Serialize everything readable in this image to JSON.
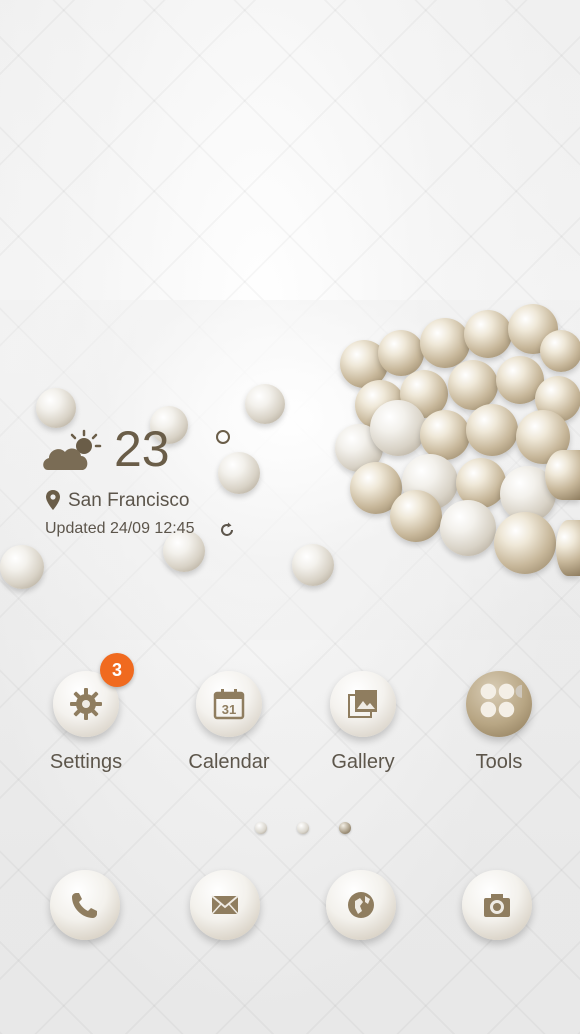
{
  "weather": {
    "temperature": "23",
    "city": "San Francisco",
    "updated": "Updated 24/09 12:45",
    "condition_icon": "partly-cloudy-icon"
  },
  "apps": [
    {
      "label": "Settings",
      "icon": "gear-icon",
      "badge": "3"
    },
    {
      "label": "Calendar",
      "icon": "calendar-icon",
      "date": "31"
    },
    {
      "label": "Gallery",
      "icon": "gallery-icon"
    },
    {
      "label": "Tools",
      "icon": "tools-folder-icon"
    }
  ],
  "dock": [
    {
      "icon": "phone-icon"
    },
    {
      "icon": "message-icon"
    },
    {
      "icon": "browser-icon"
    },
    {
      "icon": "camera-icon"
    }
  ],
  "page_indicator": {
    "pages": 3,
    "current": 3
  },
  "colors": {
    "accent": "#6a5d48",
    "badge": "#f06a1f"
  }
}
